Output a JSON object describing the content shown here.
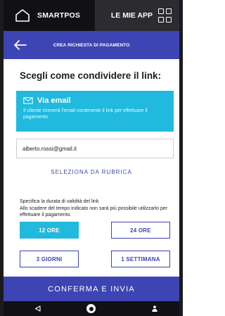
{
  "topbar": {
    "home_label": "SMARTPOS",
    "apps_label": "LE MIE APP"
  },
  "titlebar": {
    "title": "CREA RICHIESTA DI PAGAMENTO"
  },
  "share": {
    "heading": "Scegli come condividere il link:",
    "email_option": {
      "title": "Via email",
      "description": "Il cliente riceverà l'email contenente il link per effettuare il pagamento."
    },
    "email_value": "alberto.rossi@gmail.it",
    "rubrica_label": "SELEZIONA DA RUBRICA"
  },
  "duration": {
    "title": "Specifica la durata di validità del link",
    "description": "Allo scadere del tempo indicato non sarà più possibile utilizzarlo per effettuare il pagamento.",
    "options": [
      "12 ORE",
      "24 ORE",
      "3 GIORNI",
      "1 SETTIMANA"
    ],
    "selected": "12 ORE"
  },
  "confirm_label": "CONFERMA E INVIA",
  "colors": {
    "primary": "#3d44b3",
    "accent": "#21b9dd",
    "dark": "#111115"
  },
  "icons": {
    "home": "home-outline-icon",
    "apps": "grid-icon",
    "back": "arrow-left-icon",
    "email": "envelope-icon",
    "nav_back": "triangle-back-icon",
    "nav_home": "circle-home-icon",
    "nav_user": "person-icon"
  }
}
